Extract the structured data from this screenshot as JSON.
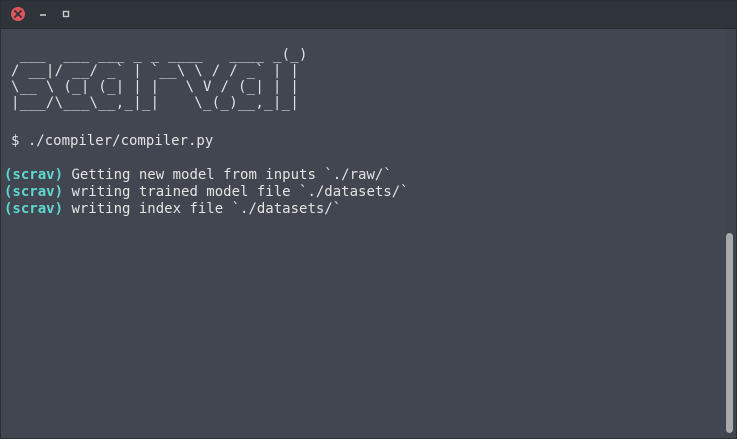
{
  "window": {
    "controls": {
      "close_icon": "close-icon",
      "minimize_glyph": "‒",
      "maximize_glyph": "▫"
    }
  },
  "terminal": {
    "banner": " ___  ___ ___ _ _ ____   ____ _(_)\n/ __|/ __/ _` | `__\\ \\ / / _` | |\n\\__ \\ (_| (_| | |   \\ V / (_| | |\n|___/\\___\\__,_|_|    \\_(_)__,_|_|",
    "prompt_line": "$ ./compiler/compiler.py",
    "output": [
      {
        "tag": "(scrav)",
        "text": " Getting new model from inputs `./raw/`"
      },
      {
        "tag": "(scrav)",
        "text": " writing trained model file `./datasets/`"
      },
      {
        "tag": "(scrav)",
        "text": " writing index file `./datasets/`"
      }
    ]
  },
  "colors": {
    "background": "#414650",
    "titlebar": "#2f333a",
    "text": "#e3e3e3",
    "accent": "#5fd7d2",
    "close_button": "#e0555a"
  }
}
